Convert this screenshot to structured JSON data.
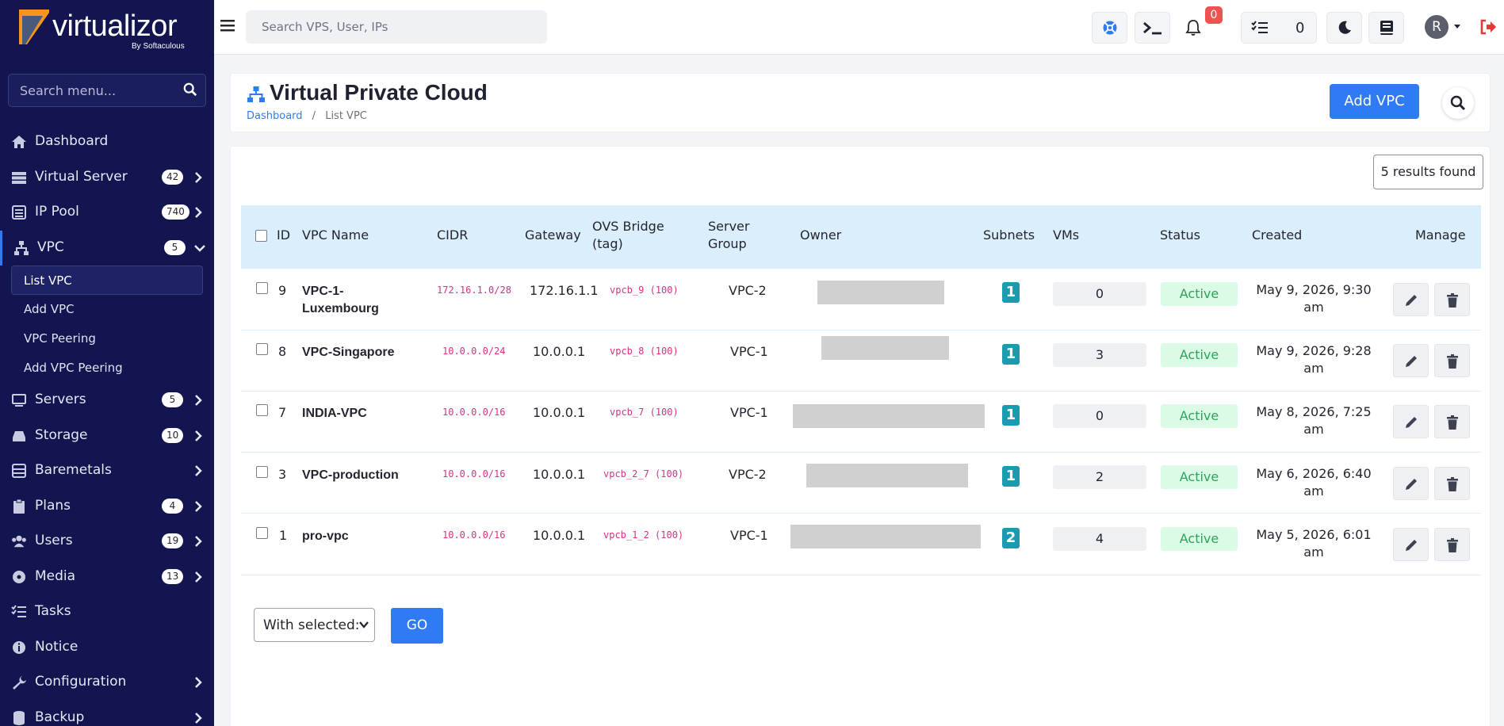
{
  "brand": {
    "name": "virtualizor",
    "sub": "By Softaculous",
    "accent": "#2f7bf6",
    "sidebar_bg": "#121550"
  },
  "sidebar": {
    "search_placeholder": "Search menu...",
    "items": [
      {
        "label": "Dashboard",
        "icon": "home-icon",
        "badge": null,
        "chevron": false
      },
      {
        "label": "Virtual Server",
        "icon": "server-stack-icon",
        "badge": "42",
        "chevron": true
      },
      {
        "label": "IP Pool",
        "icon": "list-icon",
        "badge": "740",
        "chevron": true
      },
      {
        "label": "VPC",
        "icon": "network-icon",
        "badge": "5",
        "chevron": "down"
      },
      {
        "label": "Servers",
        "icon": "server-icon",
        "badge": "5",
        "chevron": true
      },
      {
        "label": "Storage",
        "icon": "storage-icon",
        "badge": "10",
        "chevron": true
      },
      {
        "label": "Baremetals",
        "icon": "baremetal-icon",
        "badge": null,
        "chevron": true
      },
      {
        "label": "Plans",
        "icon": "clipboard-icon",
        "badge": "4",
        "chevron": true
      },
      {
        "label": "Users",
        "icon": "users-icon",
        "badge": "19",
        "chevron": true
      },
      {
        "label": "Media",
        "icon": "disc-icon",
        "badge": "13",
        "chevron": true
      },
      {
        "label": "Tasks",
        "icon": "tasks-icon",
        "badge": null,
        "chevron": false
      },
      {
        "label": "Notice",
        "icon": "info-icon",
        "badge": null,
        "chevron": false
      },
      {
        "label": "Configuration",
        "icon": "wrench-icon",
        "badge": null,
        "chevron": true
      },
      {
        "label": "Backup",
        "icon": "database-icon",
        "badge": null,
        "chevron": true
      }
    ],
    "vpc_sub": [
      "List VPC",
      "Add VPC",
      "VPC Peering",
      "Add VPC Peering"
    ]
  },
  "topbar": {
    "search_placeholder": "Search VPS, User, IPs",
    "notifications": "0",
    "tasks_count": "0",
    "avatar_letter": "R"
  },
  "page": {
    "title": "Virtual Private Cloud",
    "breadcrumb_home": "Dashboard",
    "breadcrumb_sep": "/",
    "breadcrumb_current": "List VPC",
    "add_button": "Add VPC",
    "results": "5 results found"
  },
  "table": {
    "headers": {
      "id": "ID",
      "name": "VPC Name",
      "cidr": "CIDR",
      "gateway": "Gateway",
      "ovs1": "OVS Bridge",
      "ovs2": "(tag)",
      "sg1": "Server",
      "sg2": "Group",
      "owner": "Owner",
      "subnets": "Subnets",
      "vms": "VMs",
      "status": "Status",
      "created": "Created",
      "manage": "Manage"
    },
    "rows": [
      {
        "id": "9",
        "name1": "VPC-1-",
        "name2": "Luxembourg",
        "cidr": "172.16.1.0/28",
        "gateway": "172.16.1.1",
        "ovs": "vpcb_9 (100)",
        "group": "VPC-2",
        "subnets": "1",
        "vms": "0",
        "status": "Active",
        "created1": "May 9, 2026, 9:30 am",
        "created2": ""
      },
      {
        "id": "8",
        "name1": "VPC-Singapore",
        "name2": "",
        "cidr": "10.0.0.0/24",
        "gateway": "10.0.0.1",
        "ovs": "vpcb_8 (100)",
        "group": "VPC-1",
        "subnets": "1",
        "vms": "3",
        "status": "Active",
        "created1": "May 9, 2026, 9:28 am",
        "created2": ""
      },
      {
        "id": "7",
        "name1": "INDIA-VPC",
        "name2": "",
        "cidr": "10.0.0.0/16",
        "gateway": "10.0.0.1",
        "ovs": "vpcb_7 (100)",
        "group": "VPC-1",
        "subnets": "1",
        "vms": "0",
        "status": "Active",
        "created1": "May 8, 2026, 7:25 am",
        "created2": ""
      },
      {
        "id": "3",
        "name1": "VPC-production",
        "name2": "",
        "cidr": "10.0.0.0/16",
        "gateway": "10.0.0.1",
        "ovs": "vpcb_2_7 (100)",
        "group": "VPC-2",
        "subnets": "1",
        "vms": "2",
        "status": "Active",
        "created1": "May 6, 2026, 6:40",
        "created2": "am"
      },
      {
        "id": "1",
        "name1": "pro-vpc",
        "name2": "",
        "cidr": "10.0.0.0/16",
        "gateway": "10.0.0.1",
        "ovs": "vpcb_1_2 (100)",
        "group": "VPC-1",
        "subnets": "2",
        "vms": "4",
        "status": "Active",
        "created1": "May 5, 2026, 6:01 am",
        "created2": ""
      }
    ]
  },
  "bulk": {
    "select_label": "With selected:",
    "go": "GO"
  }
}
